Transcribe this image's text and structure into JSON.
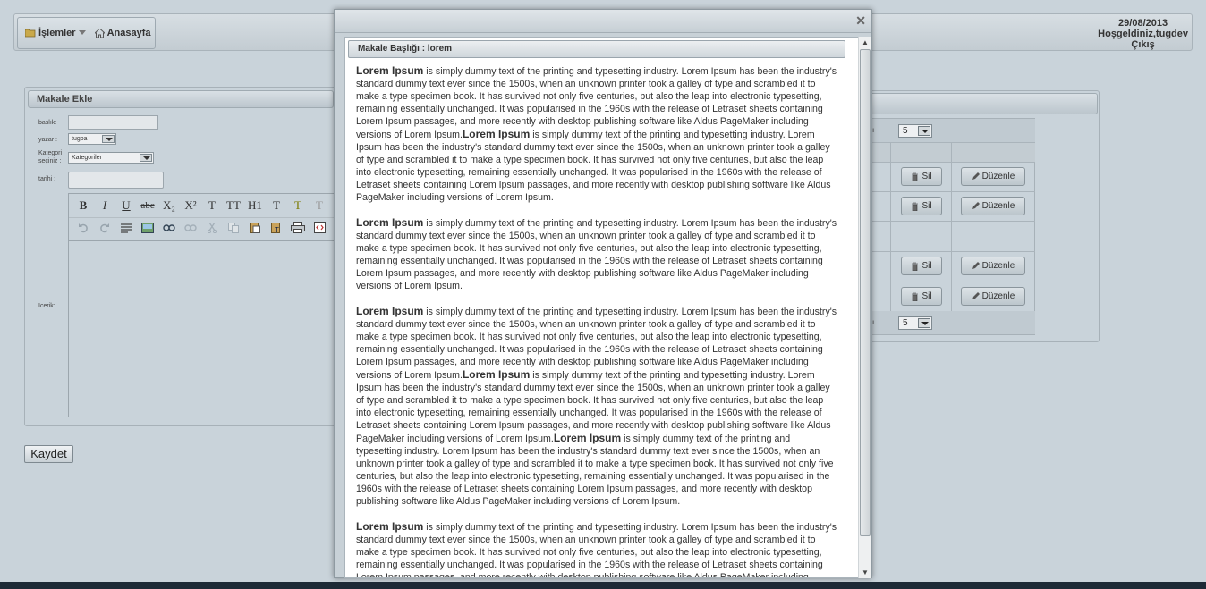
{
  "header": {
    "menu": [
      {
        "label": "İşlemler",
        "icon": "folder-icon"
      },
      {
        "label": "Anasayfa",
        "icon": "home-icon"
      }
    ],
    "date": "29/08/2013",
    "welcome": "Hoşgeldiniz,tugdev",
    "logout": "Çıkış"
  },
  "form": {
    "title": "Makale Ekle",
    "fields": {
      "title_label": "baslık:",
      "author_label": "yazar :",
      "author_value": "tugoa",
      "category_label_1": "Kategori",
      "category_label_2": "seçiniz :",
      "category_value": "Kategoriler",
      "date_label": "tarihi :",
      "content_label": "Icerik:"
    },
    "toolbar_row1": [
      "B",
      "I",
      "U",
      "abc",
      "X₂",
      "X²",
      "T",
      "TT",
      "H1",
      "T",
      "T",
      "T"
    ],
    "save_label": "Kaydet"
  },
  "list": {
    "page_size": "5",
    "pager_prev": "◂ı",
    "rows": [
      {
        "delete": "Sil",
        "edit": "Düzenle"
      },
      {
        "delete": "Sil",
        "edit": "Düzenle"
      },
      {
        "delete": "",
        "edit": ""
      },
      {
        "delete": "Sil",
        "edit": "Düzenle"
      },
      {
        "delete": "Sil",
        "edit": "Düzenle"
      }
    ]
  },
  "modal": {
    "close": "✕",
    "heading": "Makale Başlığı : lorem",
    "article": {
      "bold": "Lorem Ipsum",
      "sentence": " is simply dummy text of the printing and typesetting industry. Lorem Ipsum has been the industry's standard dummy text ever since the 1500s, when an unknown printer took a galley of type and scrambled it to make a type specimen book. It has survived not only five centuries, but also the leap into electronic typesetting, remaining essentially unchanged. It was popularised in the 1960s with the release of Letraset sheets containing Lorem Ipsum passages, and more recently with desktop publishing software like Aldus PageMaker including versions of Lorem Ipsum."
    },
    "paragraph_repeats": [
      2,
      1,
      3,
      1
    ]
  }
}
